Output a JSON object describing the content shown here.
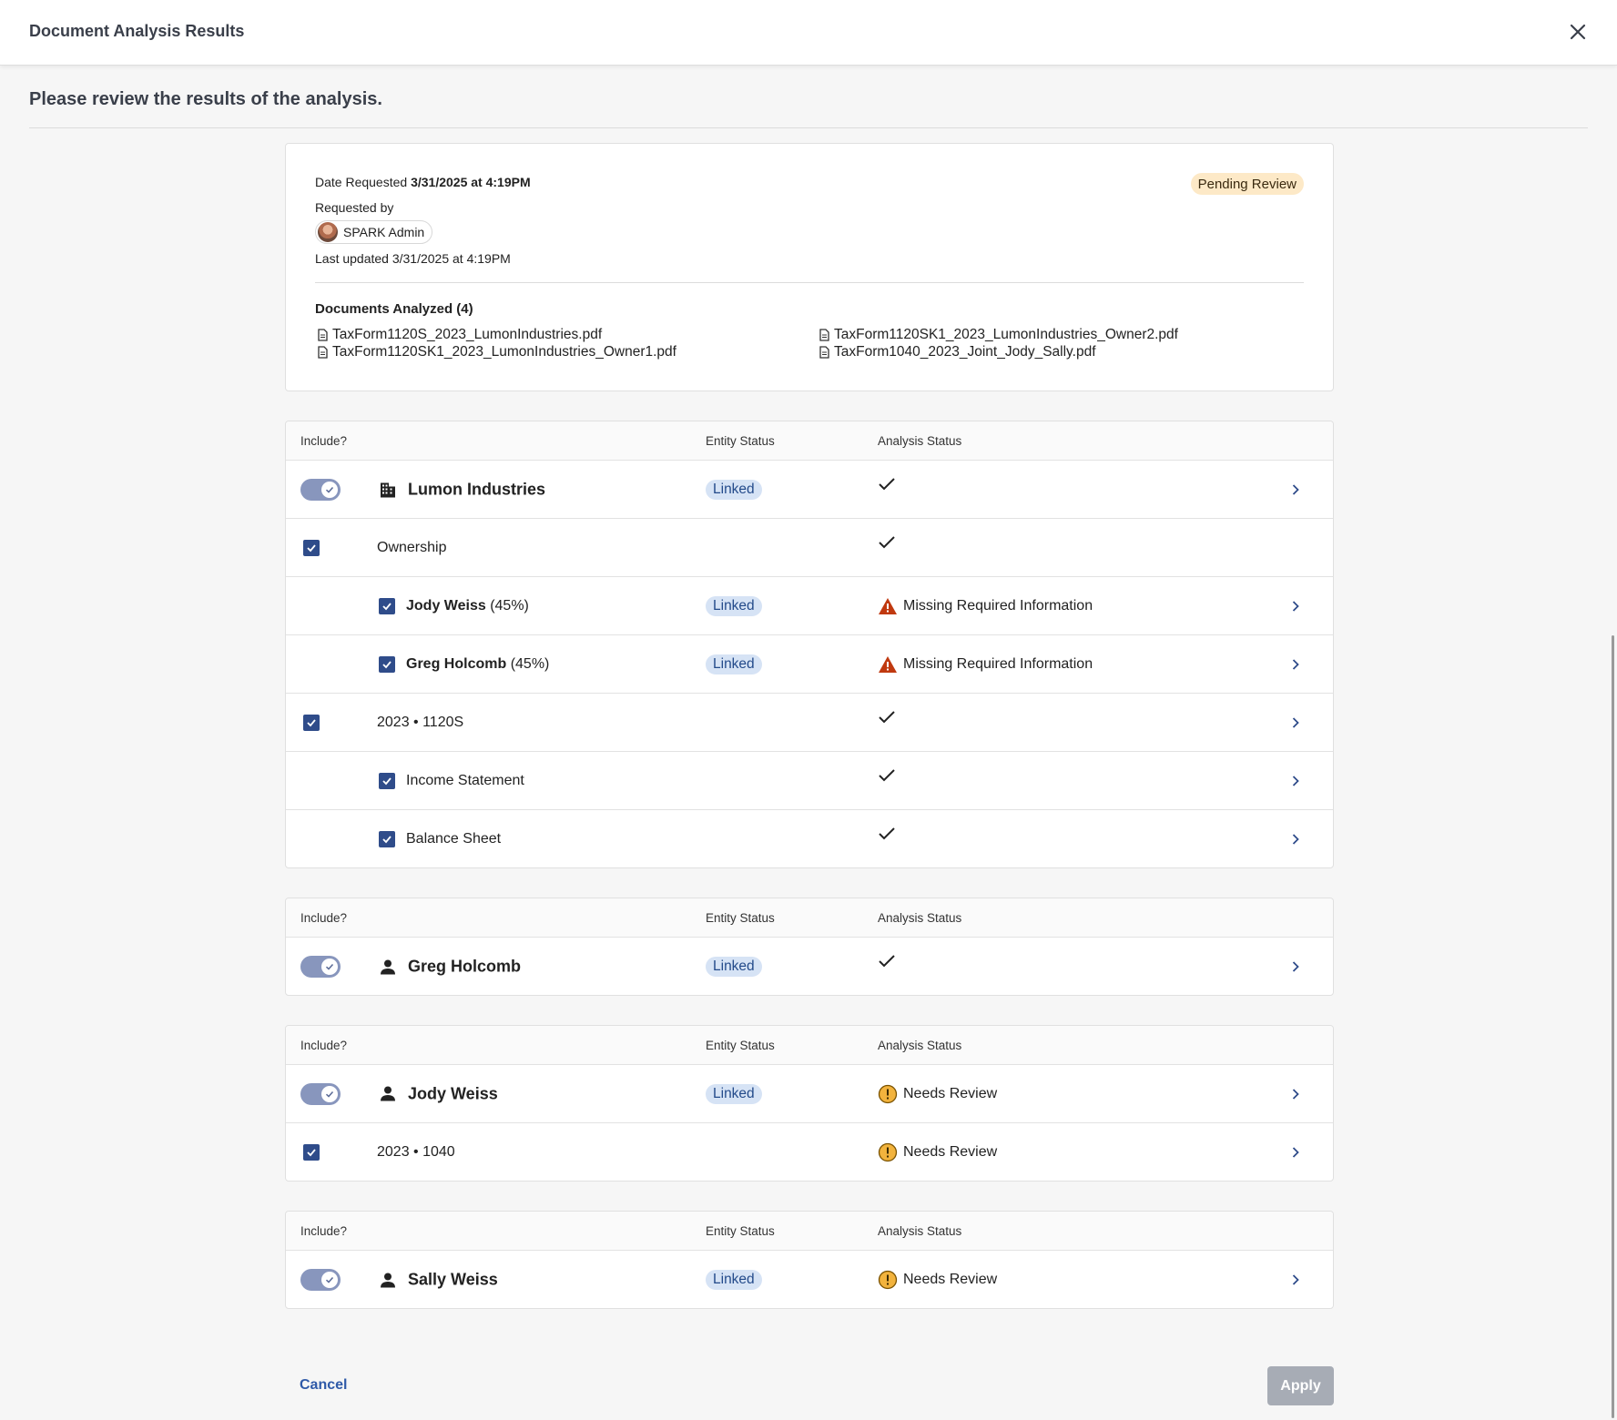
{
  "header": {
    "title": "Document Analysis Results"
  },
  "subtitle": "Please review the results of the analysis.",
  "request": {
    "date_label": "Date Requested",
    "date_value": "3/31/2025 at 4:19PM",
    "requested_by_label": "Requested by",
    "requested_by_name": "SPARK Admin",
    "last_updated": "Last updated 3/31/2025 at 4:19PM",
    "status": "Pending Review"
  },
  "documents": {
    "title": "Documents Analyzed (4)",
    "files": [
      "TaxForm1120S_2023_LumonIndustries.pdf",
      "TaxForm1120SK1_2023_LumonIndustries_Owner1.pdf",
      "TaxForm1120SK1_2023_LumonIndustries_Owner2.pdf",
      "TaxForm1040_2023_Joint_Jody_Sally.pdf"
    ]
  },
  "table_headers": {
    "include": "Include?",
    "entity_status": "Entity Status",
    "analysis_status": "Analysis Status"
  },
  "groups": [
    {
      "entity": {
        "name": "Lumon Industries",
        "icon": "building-icon",
        "entity_status": "Linked",
        "analysis_status": "check"
      },
      "rows": [
        {
          "label": "Ownership",
          "analysis_status": "check"
        },
        {
          "name": "Jody Weiss",
          "pct": "(45%)",
          "entity_status": "Linked",
          "analysis_status": "Missing Required Information"
        },
        {
          "name": "Greg Holcomb",
          "pct": "(45%)",
          "entity_status": "Linked",
          "analysis_status": "Missing Required Information"
        },
        {
          "label": "2023 • 1120S",
          "analysis_status": "check"
        },
        {
          "label": "Income Statement",
          "analysis_status": "check"
        },
        {
          "label": "Balance Sheet",
          "analysis_status": "check"
        }
      ]
    },
    {
      "entity": {
        "name": "Greg Holcomb",
        "icon": "person-icon",
        "entity_status": "Linked",
        "analysis_status": "check"
      },
      "rows": []
    },
    {
      "entity": {
        "name": "Jody Weiss",
        "icon": "person-icon",
        "entity_status": "Linked",
        "analysis_status": "Needs Review"
      },
      "rows": [
        {
          "label": "2023 • 1040",
          "analysis_status": "Needs Review"
        }
      ]
    },
    {
      "entity": {
        "name": "Sally Weiss",
        "icon": "person-icon",
        "entity_status": "Linked",
        "analysis_status": "Needs Review"
      },
      "rows": []
    }
  ],
  "footer": {
    "cancel_label": "Cancel",
    "apply_label": "Apply"
  },
  "colors": {
    "accent": "#2f4c8a",
    "linked_bg": "#d6e3f5",
    "warning_red": "#c0390f",
    "warning_amber": "#f2b33d",
    "pending_bg": "#fde9c7"
  }
}
